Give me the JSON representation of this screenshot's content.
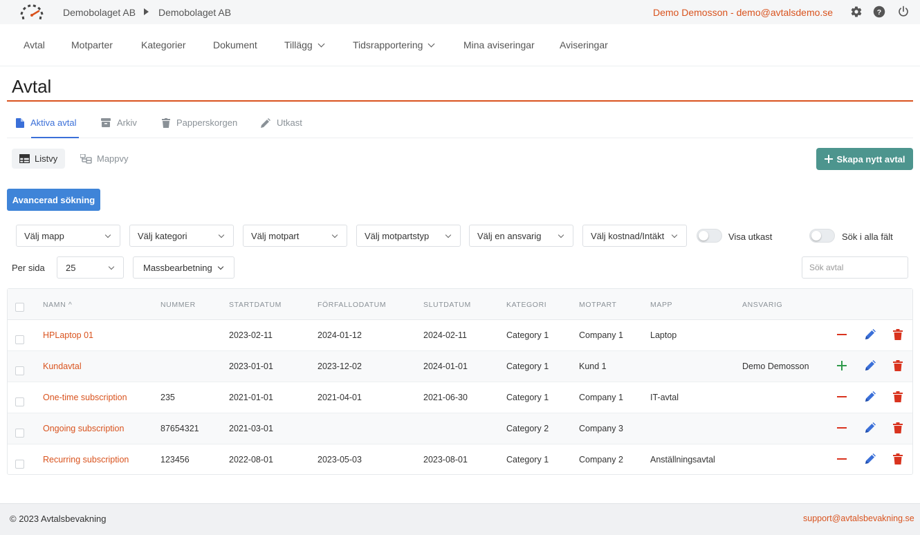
{
  "header": {
    "breadcrumb": [
      "Demobolaget AB",
      "Demobolaget AB"
    ],
    "user": "Demo Demosson - demo@avtalsdemo.se"
  },
  "nav": {
    "items": [
      "Avtal",
      "Motparter",
      "Kategorier",
      "Dokument",
      "Tillägg",
      "Tidsrapportering",
      "Mina aviseringar",
      "Aviseringar"
    ]
  },
  "page": {
    "title": "Avtal"
  },
  "tabs": [
    "Aktiva avtal",
    "Arkiv",
    "Papperskorgen",
    "Utkast"
  ],
  "views": [
    "Listvy",
    "Mappvy"
  ],
  "create_button": "Skapa nytt avtal",
  "advanced_search": "Avancerad sökning",
  "filters": [
    "Välj mapp",
    "Välj kategori",
    "Välj motpart",
    "Välj motpartstyp",
    "Välj en ansvarig",
    "Välj kostnad/Intäkt"
  ],
  "toggles": [
    "Visa utkast",
    "Sök i alla fält"
  ],
  "per_page": {
    "label": "Per sida",
    "value": "25"
  },
  "mass_button": "Massbearbetning",
  "search": {
    "placeholder": "Sök avtal"
  },
  "table": {
    "columns": [
      "NAMN",
      "NUMMER",
      "STARTDATUM",
      "FÖRFALLODATUM",
      "SLUTDATUM",
      "KATEGORI",
      "MOTPART",
      "MAPP",
      "ANSVARIG"
    ],
    "rows": [
      [
        "HPLaptop 01",
        "",
        "2023-02-11",
        "2024-01-12",
        "2024-02-11",
        "Category 1",
        "Company 1",
        "Laptop",
        ""
      ],
      [
        "Kundavtal",
        "",
        "2023-01-01",
        "2023-12-02",
        "2024-01-01",
        "Category 1",
        "Kund 1",
        "",
        "Demo Demosson"
      ],
      [
        "One-time subscription",
        "235",
        "2021-01-01",
        "2021-04-01",
        "2021-06-30",
        "Category 1",
        "Company 1",
        "IT-avtal",
        ""
      ],
      [
        "Ongoing subscription",
        "87654321",
        "2021-03-01",
        "",
        "",
        "Category 2",
        "Company 3",
        "",
        ""
      ],
      [
        "Recurring subscription",
        "123456",
        "2022-08-01",
        "2023-05-03",
        "2023-08-01",
        "Category 1",
        "Company 2",
        "Anställningsavtal",
        ""
      ]
    ],
    "row_toggle_icons": [
      "minus-icon",
      "plus-icon",
      "minus-icon",
      "minus-icon",
      "minus-icon"
    ]
  },
  "footer": {
    "copyright": "© 2023 Avtalsbevakning",
    "support": "support@avtalsbevakning.se"
  },
  "colors": {
    "accent": "#d9531e",
    "primary": "#3f84d8",
    "create": "#4d958e",
    "active_tab": "#3a6fd8"
  }
}
